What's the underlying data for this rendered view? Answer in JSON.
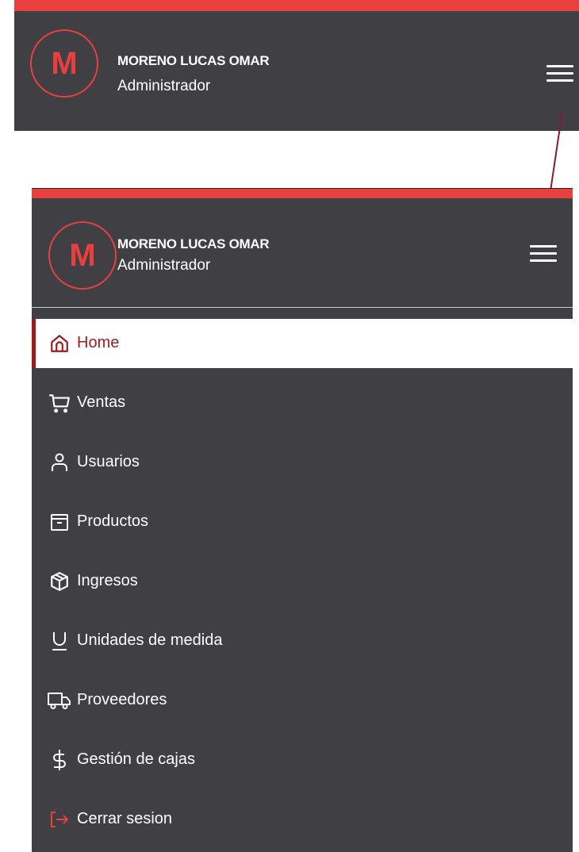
{
  "user": {
    "initial": "M",
    "name": "MORENO LUCAS OMAR",
    "role": "Administrador"
  },
  "menu": {
    "items": [
      {
        "label": "Home",
        "icon": "home-icon",
        "active": true
      },
      {
        "label": "Ventas",
        "icon": "cart-icon",
        "active": false
      },
      {
        "label": "Usuarios",
        "icon": "user-icon",
        "active": false
      },
      {
        "label": "Productos",
        "icon": "archive-icon",
        "active": false
      },
      {
        "label": "Ingresos",
        "icon": "box-icon",
        "active": false
      },
      {
        "label": "Unidades de medida",
        "icon": "unit-icon",
        "active": false
      },
      {
        "label": "Proveedores",
        "icon": "truck-icon",
        "active": false
      },
      {
        "label": "Gestión de cajas",
        "icon": "dollar-icon",
        "active": false
      },
      {
        "label": "Cerrar sesion",
        "icon": "logout-icon",
        "active": false
      }
    ]
  },
  "colors": {
    "accent": "#e8403f",
    "panel_bg": "#3f3f44",
    "active_text": "#9b1c1c"
  }
}
